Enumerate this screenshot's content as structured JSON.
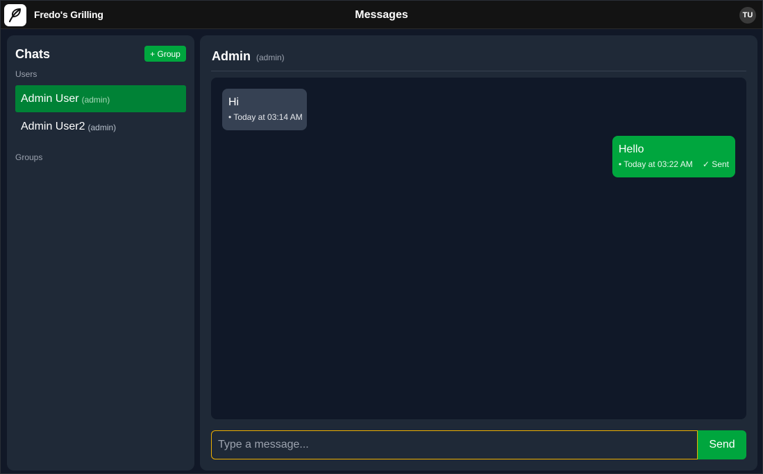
{
  "app": {
    "brand": "Fredo's Grilling",
    "page_title": "Messages",
    "user_initials": "TU",
    "accent_color": "#00a63e",
    "logo_icon": "leaf-icon"
  },
  "sidebar": {
    "title": "Chats",
    "new_group_label": "+ Group",
    "users_label": "Users",
    "users": [
      {
        "name": "Admin User",
        "role": "(admin)",
        "active": true
      },
      {
        "name": "Admin User2",
        "role": "(admin)",
        "active": false
      }
    ],
    "groups_label": "Groups"
  },
  "chat": {
    "name": "Admin",
    "role": "(admin)",
    "messages": [
      {
        "direction": "incoming",
        "text": "Hi",
        "time": "• Today at 03:14 AM",
        "status": ""
      },
      {
        "direction": "outgoing",
        "text": "Hello",
        "time": "• Today at 03:22 AM",
        "status": "✓ Sent"
      }
    ],
    "input_placeholder": "Type a message...",
    "send_label": "Send"
  }
}
